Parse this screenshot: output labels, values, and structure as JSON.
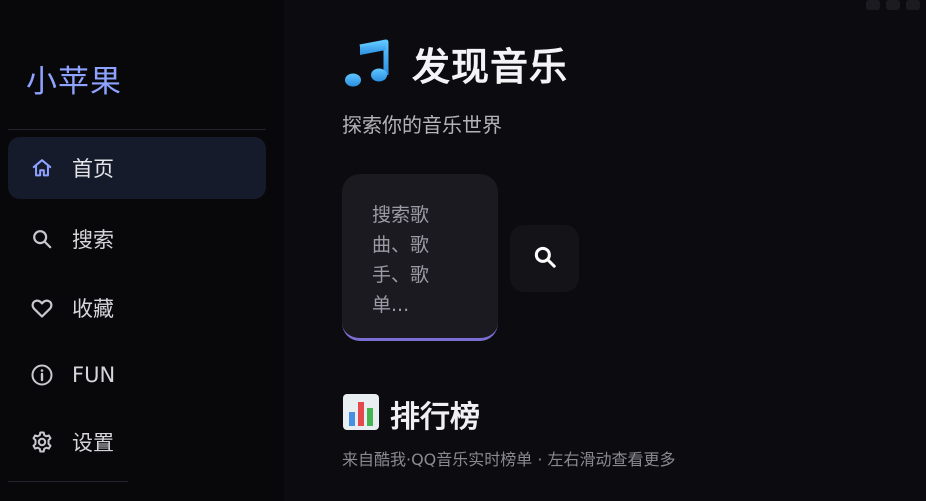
{
  "app": {
    "name": "小苹果"
  },
  "sidebar": {
    "items": [
      {
        "label": "首页",
        "icon": "home-icon",
        "active": true
      },
      {
        "label": "搜索",
        "icon": "search-icon",
        "active": false
      },
      {
        "label": "收藏",
        "icon": "heart-icon",
        "active": false
      },
      {
        "label": "FUN",
        "icon": "info-icon",
        "active": false
      },
      {
        "label": "设置",
        "icon": "gear-icon",
        "active": false
      }
    ]
  },
  "main": {
    "title": "发现音乐",
    "title_icon": "music-note-icon",
    "subtitle": "探索你的音乐世界",
    "search": {
      "placeholder": "搜索歌曲、歌手、歌单..."
    },
    "section": {
      "title": "排行榜",
      "icon": "bar-chart-icon",
      "subtitle": "来自酷我·QQ音乐实时榜单 · 左右滑动查看更多"
    }
  },
  "colors": {
    "accent": "#8ea2ff",
    "background": "#0c0b0f",
    "sidebar": "#08080a",
    "active_item": "#161b2b",
    "search_underline": "#7c6fd3"
  }
}
